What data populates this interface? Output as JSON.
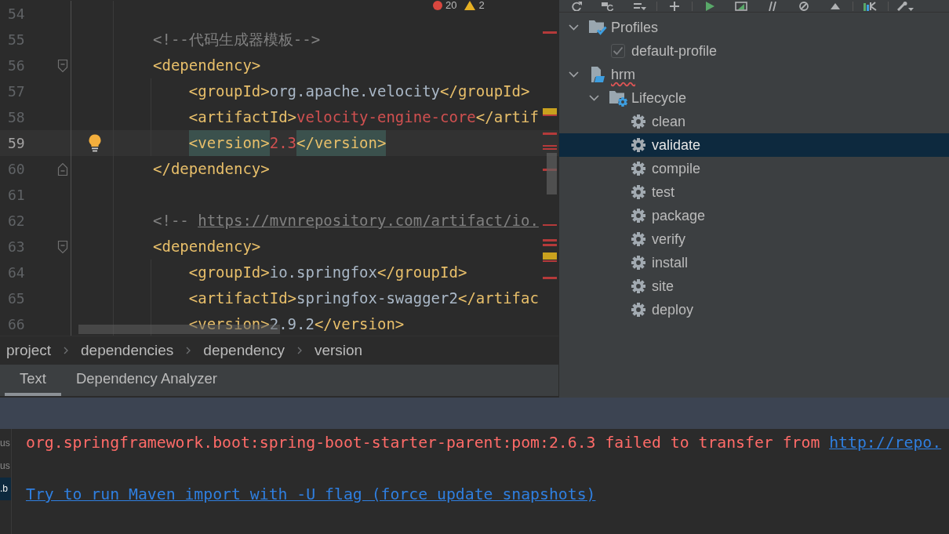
{
  "editor": {
    "inspection": {
      "errors": "20",
      "warnings": "2"
    },
    "lines": [
      {
        "number": "54",
        "current": false
      },
      {
        "number": "55",
        "current": false,
        "tokens": [
          {
            "kind": "comment",
            "text": "<!--代码生成器模板-->"
          }
        ]
      },
      {
        "number": "56",
        "current": false,
        "fold_start": true,
        "tokens": [
          {
            "kind": "tag",
            "text": "<dependency>"
          }
        ],
        "children": [
          {
            "number": "57",
            "current": false,
            "tokens": [
              {
                "kind": "tag",
                "text": "<groupId>"
              },
              {
                "kind": "value",
                "text": "org.apache.velocity"
              },
              {
                "kind": "tag",
                "text": "</groupId>"
              }
            ]
          },
          {
            "number": "58",
            "current": false,
            "tokens": [
              {
                "kind": "tag",
                "text": "<artifactId>"
              },
              {
                "kind": "unresolved",
                "text": "velocity-engine-core"
              },
              {
                "kind": "tag",
                "text": "</artif"
              }
            ]
          },
          {
            "number": "59",
            "current": true,
            "bulb": true,
            "tokens": [
              {
                "kind": "matched-tag",
                "text": "<version>"
              },
              {
                "kind": "unresolved",
                "text": "2.3"
              },
              {
                "kind": "matched-tag",
                "text": "</version>"
              }
            ]
          }
        ]
      },
      {
        "number": "60",
        "current": false,
        "fold_end": true,
        "tokens": [
          {
            "kind": "tag",
            "text": "</dependency>"
          }
        ]
      },
      {
        "number": "61",
        "current": false
      },
      {
        "number": "62",
        "current": false,
        "tokens": [
          {
            "kind": "comment",
            "text": "<!-- "
          },
          {
            "kind": "link",
            "text": "https://mvnrepository.com/artifact/io."
          }
        ]
      },
      {
        "number": "63",
        "current": false,
        "fold_start": true,
        "tokens": [
          {
            "kind": "tag",
            "text": "<dependency>"
          }
        ],
        "children": [
          {
            "number": "64",
            "current": false,
            "tokens": [
              {
                "kind": "tag",
                "text": "<groupId>"
              },
              {
                "kind": "value",
                "text": "io.springfox"
              },
              {
                "kind": "tag",
                "text": "</groupId>"
              }
            ]
          },
          {
            "number": "65",
            "current": false,
            "tokens": [
              {
                "kind": "tag",
                "text": "<artifactId>"
              },
              {
                "kind": "value",
                "text": "springfox-swagger2"
              },
              {
                "kind": "tag",
                "text": "</artifac"
              }
            ]
          },
          {
            "number": "66",
            "current": false,
            "tokens": [
              {
                "kind": "tag",
                "text": "<version>"
              },
              {
                "kind": "value",
                "text": "2.9.2"
              },
              {
                "kind": "tag",
                "text": "</version>"
              }
            ]
          }
        ]
      }
    ]
  },
  "breadcrumbs": [
    "project",
    "dependencies",
    "dependency",
    "version"
  ],
  "editor_tabs": [
    {
      "label": "Text",
      "selected": true
    },
    {
      "label": "Dependency Analyzer",
      "selected": false
    }
  ],
  "maven": {
    "tree": [
      {
        "label": "Profiles",
        "kind": "profiles",
        "expanded": true,
        "selected": false,
        "problem": false,
        "children": [
          {
            "label": "default-profile",
            "kind": "profile",
            "checked": true,
            "selected": false,
            "problem": false
          }
        ]
      },
      {
        "label": "hrm",
        "kind": "project",
        "expanded": true,
        "selected": false,
        "problem": true,
        "children": [
          {
            "label": "Lifecycle",
            "kind": "lifecycle",
            "expanded": true,
            "selected": false,
            "problem": false,
            "children": [
              {
                "label": "clean",
                "kind": "goal",
                "selected": false,
                "problem": false
              },
              {
                "label": "validate",
                "kind": "goal",
                "selected": true,
                "problem": false
              },
              {
                "label": "compile",
                "kind": "goal",
                "selected": false,
                "problem": false
              },
              {
                "label": "test",
                "kind": "goal",
                "selected": false,
                "problem": false
              },
              {
                "label": "package",
                "kind": "goal",
                "selected": false,
                "problem": false
              },
              {
                "label": "verify",
                "kind": "goal",
                "selected": false,
                "problem": false
              },
              {
                "label": "install",
                "kind": "goal",
                "selected": false,
                "problem": false
              },
              {
                "label": "site",
                "kind": "goal",
                "selected": false,
                "problem": false
              },
              {
                "label": "deploy",
                "kind": "goal",
                "selected": false,
                "problem": false
              }
            ]
          }
        ]
      }
    ]
  },
  "build": {
    "tree": [
      {
        "label": "us",
        "selected": false
      },
      {
        "label": "us",
        "selected": false
      },
      {
        "label": ".b",
        "selected": true
      }
    ],
    "console": [
      {
        "segments": [
          {
            "kind": "error",
            "text": "org.springframework.boot:spring-boot-starter-parent:pom:2.6.3 failed to transfer from "
          },
          {
            "kind": "link",
            "text": "http://repo."
          }
        ]
      },
      {
        "segments": [
          {
            "kind": "link",
            "text": "Try to run Maven import with -U flag (force update snapshots)"
          }
        ]
      }
    ]
  }
}
